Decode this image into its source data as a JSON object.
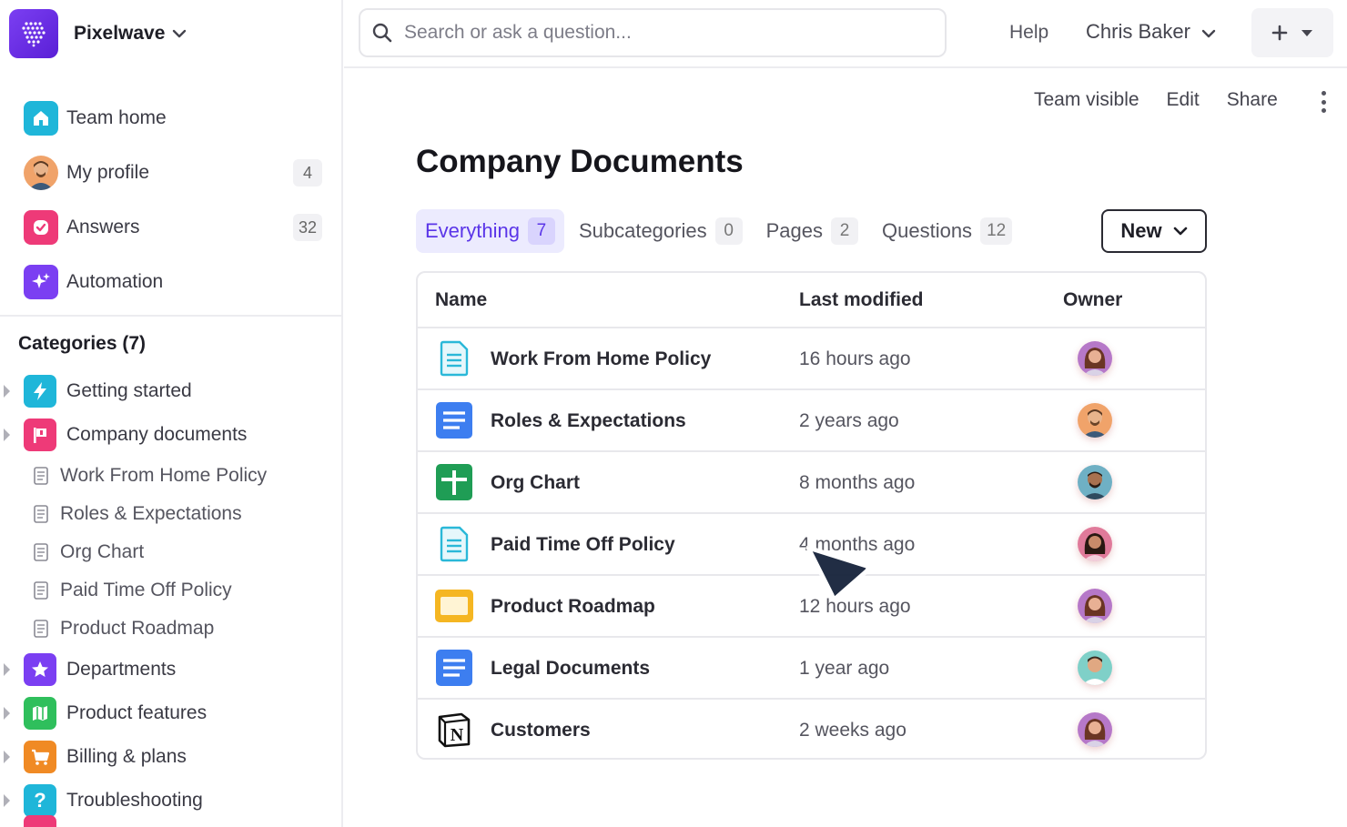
{
  "workspace": {
    "name": "Pixelwave"
  },
  "search": {
    "placeholder": "Search or ask a question..."
  },
  "topbar": {
    "help": "Help",
    "user": "Chris Baker"
  },
  "nav": [
    {
      "label": "Team home",
      "icon": "home-icon"
    },
    {
      "label": "My profile",
      "icon": "avatar",
      "count": "4"
    },
    {
      "label": "Answers",
      "icon": "answers-icon",
      "count": "32"
    },
    {
      "label": "Automation",
      "icon": "sparkle-icon"
    }
  ],
  "categories": {
    "title": "Categories (7)",
    "items": [
      {
        "label": "Getting started",
        "icon": "lightning-icon",
        "color": "#1fb6d9"
      },
      {
        "label": "Company documents",
        "icon": "flag-icon",
        "color": "#ee3a78",
        "children": [
          "Work From Home Policy",
          "Roles & Expectations",
          "Org Chart",
          "Paid Time Off Policy",
          "Product Roadmap"
        ]
      },
      {
        "label": "Departments",
        "icon": "star-icon",
        "color": "#7b3ff2"
      },
      {
        "label": "Product features",
        "icon": "map-icon",
        "color": "#2fbf5c"
      },
      {
        "label": "Billing & plans",
        "icon": "cart-icon",
        "color": "#f08a24"
      },
      {
        "label": "Troubleshooting",
        "icon": "question-icon",
        "color": "#1fb6d9"
      }
    ]
  },
  "page": {
    "actions": {
      "visibility": "Team visible",
      "edit": "Edit",
      "share": "Share"
    },
    "title": "Company Documents",
    "tabs": [
      {
        "label": "Everything",
        "count": "7",
        "active": true
      },
      {
        "label": "Subcategories",
        "count": "0"
      },
      {
        "label": "Pages",
        "count": "2"
      },
      {
        "label": "Questions",
        "count": "12"
      }
    ],
    "new_button": "New"
  },
  "table": {
    "headers": {
      "name": "Name",
      "modified": "Last modified",
      "owner": "Owner"
    },
    "rows": [
      {
        "name": "Work From Home Policy",
        "modified": "16 hours ago",
        "icon": "doc-light-icon"
      },
      {
        "name": "Roles & Expectations",
        "modified": "2 years ago",
        "icon": "doc-blue-icon"
      },
      {
        "name": "Org Chart",
        "modified": "8 months ago",
        "icon": "sheet-green-icon"
      },
      {
        "name": "Paid Time Off Policy",
        "modified": "4 months ago",
        "icon": "doc-light-icon"
      },
      {
        "name": "Product Roadmap",
        "modified": "12 hours ago",
        "icon": "slides-yellow-icon"
      },
      {
        "name": "Legal Documents",
        "modified": "1 year ago",
        "icon": "doc-blue-icon"
      },
      {
        "name": "Customers",
        "modified": "2 weeks ago",
        "icon": "notion-icon"
      }
    ]
  },
  "colors": {
    "accent": "#5a35e8",
    "accent_bg": "#ecebfe"
  }
}
